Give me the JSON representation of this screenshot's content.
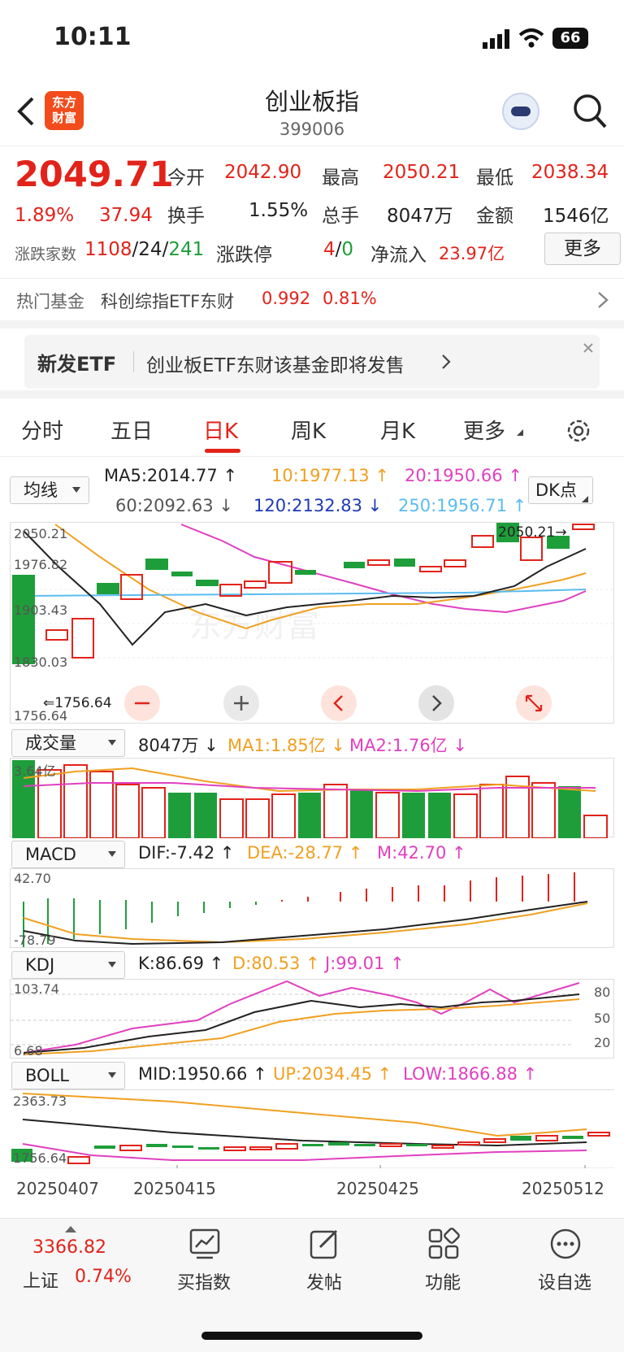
{
  "status": {
    "time": "10:11",
    "battery": "66"
  },
  "header": {
    "logo_line1": "东方",
    "logo_line2": "财富",
    "title": "创业板指",
    "code": "399006"
  },
  "quote": {
    "price": "2049.71",
    "change_pct": "1.89%",
    "change": "37.94",
    "open_label": "今开",
    "open": "2042.90",
    "high_label": "最高",
    "high": "2050.21",
    "low_label": "最低",
    "low": "2038.34",
    "turnover_label": "换手",
    "turnover": "1.55%",
    "volume_label": "总手",
    "volume": "8047万",
    "amount_label": "金额",
    "amount": "1546亿",
    "breadth_label": "涨跌家数",
    "breadth_up": "1108",
    "breadth_flat": "24",
    "breadth_down": "241",
    "slash": "/",
    "limit_label": "涨跌停",
    "limit_up": "4",
    "limit_down": "0",
    "inflow_label": "净流入",
    "inflow": "23.97亿",
    "more_label": "更多"
  },
  "hot_fund": {
    "label": "热门基金",
    "name": "科创综指ETF东财",
    "price": "0.992",
    "pct": "0.81%"
  },
  "banner": {
    "tag": "新发ETF",
    "text": "创业板ETF东财该基金即将发售"
  },
  "tabs": [
    "分时",
    "五日",
    "日K",
    "周K",
    "月K",
    "更多"
  ],
  "ma": {
    "selector": "均线",
    "dk": "DK点",
    "ma5": "MA5:2014.77",
    "ma10": "10:1977.13",
    "ma20": "20:1950.66",
    "ma60": "60:2092.63",
    "ma120": "120:2132.83",
    "ma250": "250:1956.71"
  },
  "kline": {
    "y_top": "2050.21",
    "y2": "1976.82",
    "y3": "1903.43",
    "y4": "1830.03",
    "y_bottom": "1756.64",
    "high_mark": "2050.21",
    "low_mark": "1756.64"
  },
  "vol": {
    "selector": "成交量",
    "value": "8047万",
    "ma1": "MA1:1.85亿",
    "ma2": "MA2:1.76亿",
    "y_top": "3.64亿"
  },
  "macd": {
    "selector": "MACD",
    "dif": "DIF:-7.42",
    "dea": "DEA:-28.77",
    "m": "M:42.70",
    "y_top": "42.70",
    "y_bottom": "-78.79"
  },
  "kdj": {
    "selector": "KDJ",
    "k": "K:86.69",
    "d": "D:80.53",
    "j": "J:99.01",
    "y_top": "103.74",
    "y_bottom": "6.68",
    "l80": "80",
    "l50": "50",
    "l20": "20"
  },
  "boll": {
    "selector": "BOLL",
    "mid": "MID:1950.66",
    "up": "UP:2034.45",
    "low": "LOW:1866.88",
    "y_top": "2363.73",
    "y_bottom": "1756.64"
  },
  "dates": [
    "20250407",
    "20250415",
    "20250425",
    "20250512"
  ],
  "bottom_bar": {
    "index_value": "3366.82",
    "index_name": "上证",
    "index_pct": "0.74%",
    "buy": "买指数",
    "post": "发帖",
    "func": "功能",
    "watch": "设自选"
  },
  "colors": {
    "up": "#e2231a",
    "down": "#1e9e3a",
    "ma5": "#222222",
    "ma10": "#f0a020",
    "ma20": "#e040c0",
    "ma60": "#5bbcf0"
  }
}
